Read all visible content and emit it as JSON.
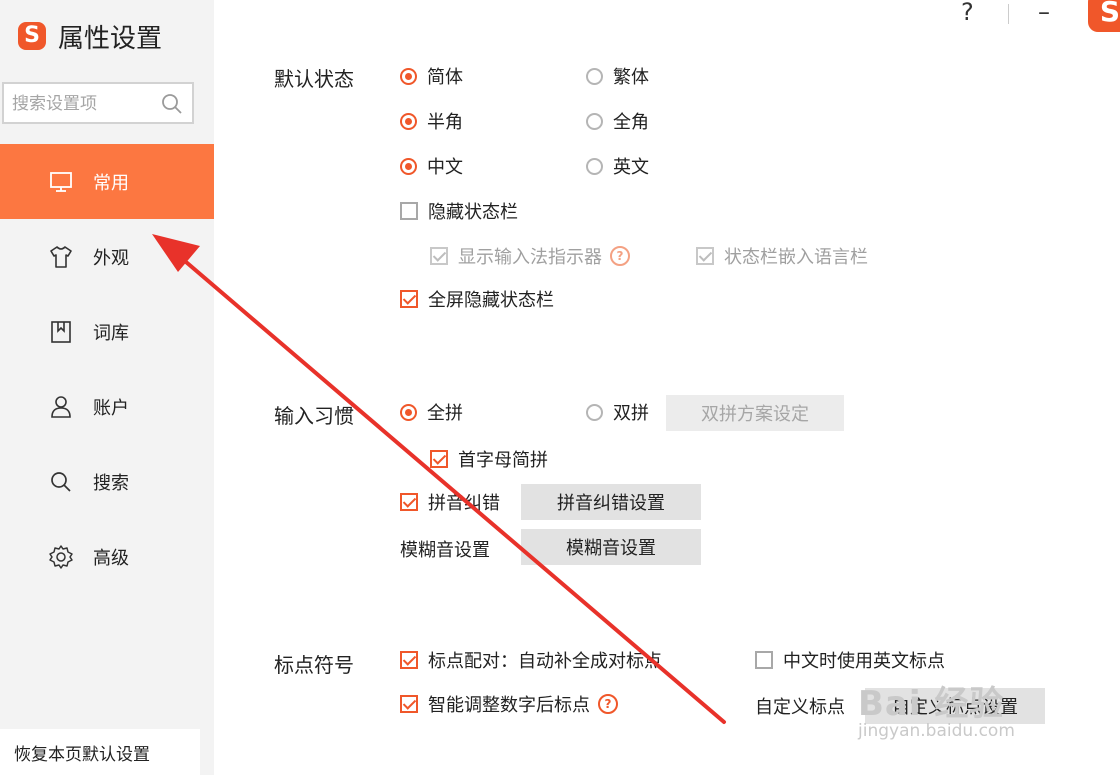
{
  "sidebar": {
    "app_title": "属性设置",
    "logo_glyph": "S",
    "search_placeholder": "搜索设置项",
    "items": [
      {
        "label": "常用",
        "icon": "monitor-icon",
        "active": true
      },
      {
        "label": "外观",
        "icon": "shirt-icon",
        "active": false
      },
      {
        "label": "词库",
        "icon": "dictionary-icon",
        "active": false
      },
      {
        "label": "账户",
        "icon": "user-icon",
        "active": false
      },
      {
        "label": "搜索",
        "icon": "search-icon",
        "active": false
      },
      {
        "label": "高级",
        "icon": "gear-icon",
        "active": false
      }
    ],
    "restore_label": "恢复本页默认设置"
  },
  "window_controls": {
    "help": "?",
    "minimize": "–"
  },
  "default_state": {
    "label": "默认状态",
    "simplified": "简体",
    "traditional": "繁体",
    "half_width": "半角",
    "full_width": "全角",
    "chinese": "中文",
    "english": "英文",
    "hide_status_bar": "隐藏状态栏",
    "show_indicator": "显示输入法指示器",
    "status_bar_embed": "状态栏嵌入语言栏",
    "fullscreen_hide": "全屏隐藏状态栏"
  },
  "input_habit": {
    "label": "输入习惯",
    "full_pinyin": "全拼",
    "double_pinyin": "双拼",
    "double_pinyin_settings": "双拼方案设定",
    "initial_abbrev": "首字母简拼",
    "pinyin_correction": "拼音纠错",
    "pinyin_correction_settings": "拼音纠错设置",
    "fuzzy_label": "模糊音设置",
    "fuzzy_button": "模糊音设置"
  },
  "punctuation": {
    "label": "标点符号",
    "auto_pair": "标点配对：自动补全成对标点",
    "english_punct_in_chinese": "中文时使用英文标点",
    "smart_adjust": "智能调整数字后标点",
    "custom_label": "自定义标点",
    "custom_button": "自定义标点设置"
  },
  "watermark": {
    "main": "Bai 经验",
    "sub": "jingyan.baidu.com"
  },
  "colors": {
    "accent": "#f0572a",
    "active_nav": "#fc7741",
    "arrow": "#e8322a"
  }
}
